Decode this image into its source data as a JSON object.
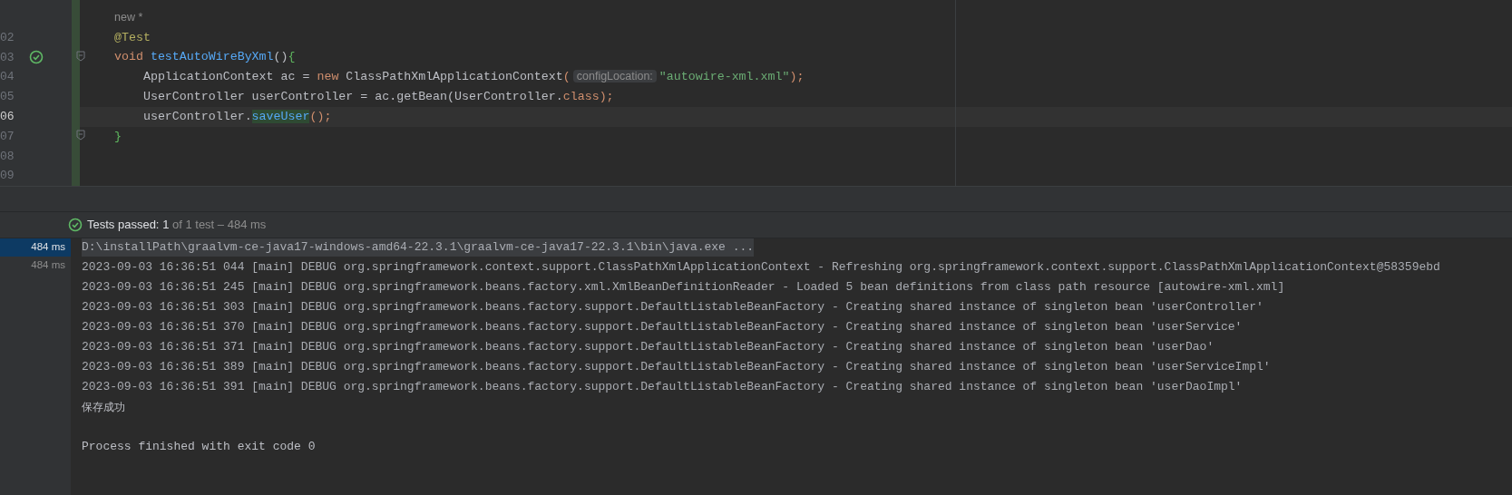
{
  "editor": {
    "author_hint": "new *",
    "lines": [
      {
        "number": "02",
        "current": false,
        "run_icon": false,
        "fold": false,
        "tokens": [
          {
            "kind": "annotation",
            "text": "@Test"
          }
        ]
      },
      {
        "number": "03",
        "current": false,
        "run_icon": true,
        "fold": true,
        "tokens": [
          {
            "kind": "keyword",
            "text": "void"
          },
          {
            "kind": "method",
            "text": " testAutoWireByXml"
          },
          {
            "kind": "plain",
            "text": "()"
          },
          {
            "kind": "brace",
            "text": "{"
          }
        ]
      },
      {
        "number": "04",
        "current": false,
        "run_icon": false,
        "fold": false,
        "tokens": [
          {
            "kind": "plain",
            "text": "    ApplicationContext ac = "
          },
          {
            "kind": "keyword",
            "text": "new"
          },
          {
            "kind": "plain",
            "text": " ClassPathXmlApplicationContext"
          },
          {
            "kind": "paren",
            "text": "("
          },
          {
            "kind": "hint",
            "text": "configLocation:"
          },
          {
            "kind": "string",
            "text": "\"autowire-xml.xml\""
          },
          {
            "kind": "paren",
            "text": ");"
          }
        ]
      },
      {
        "number": "05",
        "current": false,
        "run_icon": false,
        "fold": false,
        "tokens": [
          {
            "kind": "plain",
            "text": "    UserController userController = ac.getBean(UserController."
          },
          {
            "kind": "keyword",
            "text": "class"
          },
          {
            "kind": "paren",
            "text": ");"
          }
        ]
      },
      {
        "number": "06",
        "current": true,
        "run_icon": false,
        "fold": false,
        "tokens": [
          {
            "kind": "plain",
            "text": "    userController."
          },
          {
            "kind": "usage",
            "text": "saveUser"
          },
          {
            "kind": "paren",
            "text": "();"
          }
        ]
      },
      {
        "number": "07",
        "current": false,
        "run_icon": false,
        "fold": true,
        "tokens": [
          {
            "kind": "brace",
            "text": "}"
          }
        ]
      },
      {
        "number": "08",
        "current": false,
        "run_icon": false,
        "fold": false
      },
      {
        "number": "09",
        "current": false,
        "run_icon": false,
        "fold": false
      }
    ]
  },
  "test_status": {
    "label": "Tests passed:",
    "count": "1",
    "detail": "of 1 test – 484 ms"
  },
  "durations": [
    {
      "text": "484 ms",
      "selected": true
    },
    {
      "text": "484 ms",
      "selected": false
    }
  ],
  "console": [
    {
      "kind": "command",
      "text": "D:\\installPath\\graalvm-ce-java17-windows-amd64-22.3.1\\graalvm-ce-java17-22.3.1\\bin\\java.exe ..."
    },
    {
      "kind": "log",
      "text": "2023-09-03 16:36:51 044 [main] DEBUG org.springframework.context.support.ClassPathXmlApplicationContext - Refreshing org.springframework.context.support.ClassPathXmlApplicationContext@58359ebd"
    },
    {
      "kind": "log",
      "text": "2023-09-03 16:36:51 245 [main] DEBUG org.springframework.beans.factory.xml.XmlBeanDefinitionReader - Loaded 5 bean definitions from class path resource [autowire-xml.xml]"
    },
    {
      "kind": "log",
      "text": "2023-09-03 16:36:51 303 [main] DEBUG org.springframework.beans.factory.support.DefaultListableBeanFactory - Creating shared instance of singleton bean 'userController'"
    },
    {
      "kind": "log",
      "text": "2023-09-03 16:36:51 370 [main] DEBUG org.springframework.beans.factory.support.DefaultListableBeanFactory - Creating shared instance of singleton bean 'userService'"
    },
    {
      "kind": "log",
      "text": "2023-09-03 16:36:51 371 [main] DEBUG org.springframework.beans.factory.support.DefaultListableBeanFactory - Creating shared instance of singleton bean 'userDao'"
    },
    {
      "kind": "log",
      "text": "2023-09-03 16:36:51 389 [main] DEBUG org.springframework.beans.factory.support.DefaultListableBeanFactory - Creating shared instance of singleton bean 'userServiceImpl'"
    },
    {
      "kind": "log",
      "text": "2023-09-03 16:36:51 391 [main] DEBUG org.springframework.beans.factory.support.DefaultListableBeanFactory - Creating shared instance of singleton bean 'userDaoImpl'"
    },
    {
      "kind": "output",
      "text": "保存成功"
    },
    {
      "kind": "exit",
      "text": "Process finished with exit code 0"
    }
  ]
}
